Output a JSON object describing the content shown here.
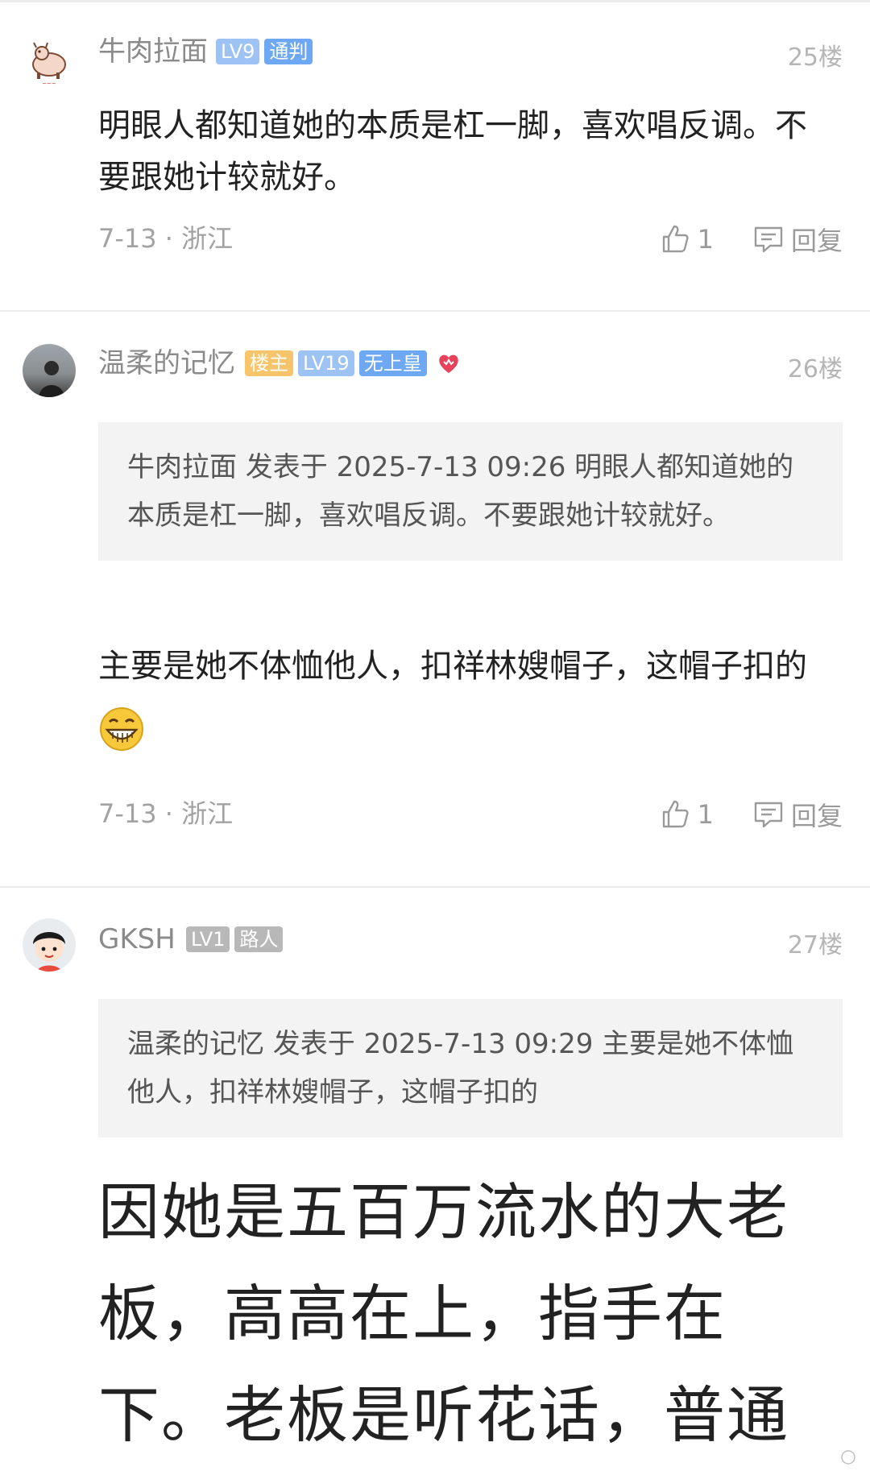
{
  "posts": [
    {
      "username": "牛肉拉面",
      "badges": [
        "LV9",
        "通判"
      ],
      "floor": "25楼",
      "content": "明眼人都知道她的本质是杠一脚，喜欢唱反调。不要跟她计较就好。",
      "meta": "7-13 · 浙江",
      "likes": "1",
      "reply_label": "回复"
    },
    {
      "username": "温柔的记忆",
      "badges": [
        "楼主",
        "LV19",
        "无上皇"
      ],
      "floor": "26楼",
      "quote": "牛肉拉面 发表于 2025-7-13 09:26 明眼人都知道她的本质是杠一脚，喜欢唱反调。不要跟她计较就好。",
      "content": "主要是她不体恤他人，扣祥林嫂帽子，这帽子扣的",
      "meta": "7-13 · 浙江",
      "likes": "1",
      "reply_label": "回复"
    },
    {
      "username": "GKSH",
      "badges": [
        "LV1",
        "路人"
      ],
      "floor": "27楼",
      "quote": "温柔的记忆 发表于 2025-7-13 09:29 主要是她不体恤他人，扣祥林嫂帽子，这帽子扣的",
      "content": "因她是五百万流水的大老板，高高在上，指手在下。老板是听花话，普通"
    }
  ],
  "icons": {
    "like": "thumbs-up-icon",
    "reply": "chat-bubble-icon",
    "heart": "heart-icon",
    "emoji": "grin-emoji-icon"
  },
  "colors": {
    "badge_lv": "#9dc3f5",
    "badge_title": "#6fa8f2",
    "badge_owner": "#f6c46a",
    "badge_gray": "#b8b8b8",
    "heart": "#e8415a"
  }
}
